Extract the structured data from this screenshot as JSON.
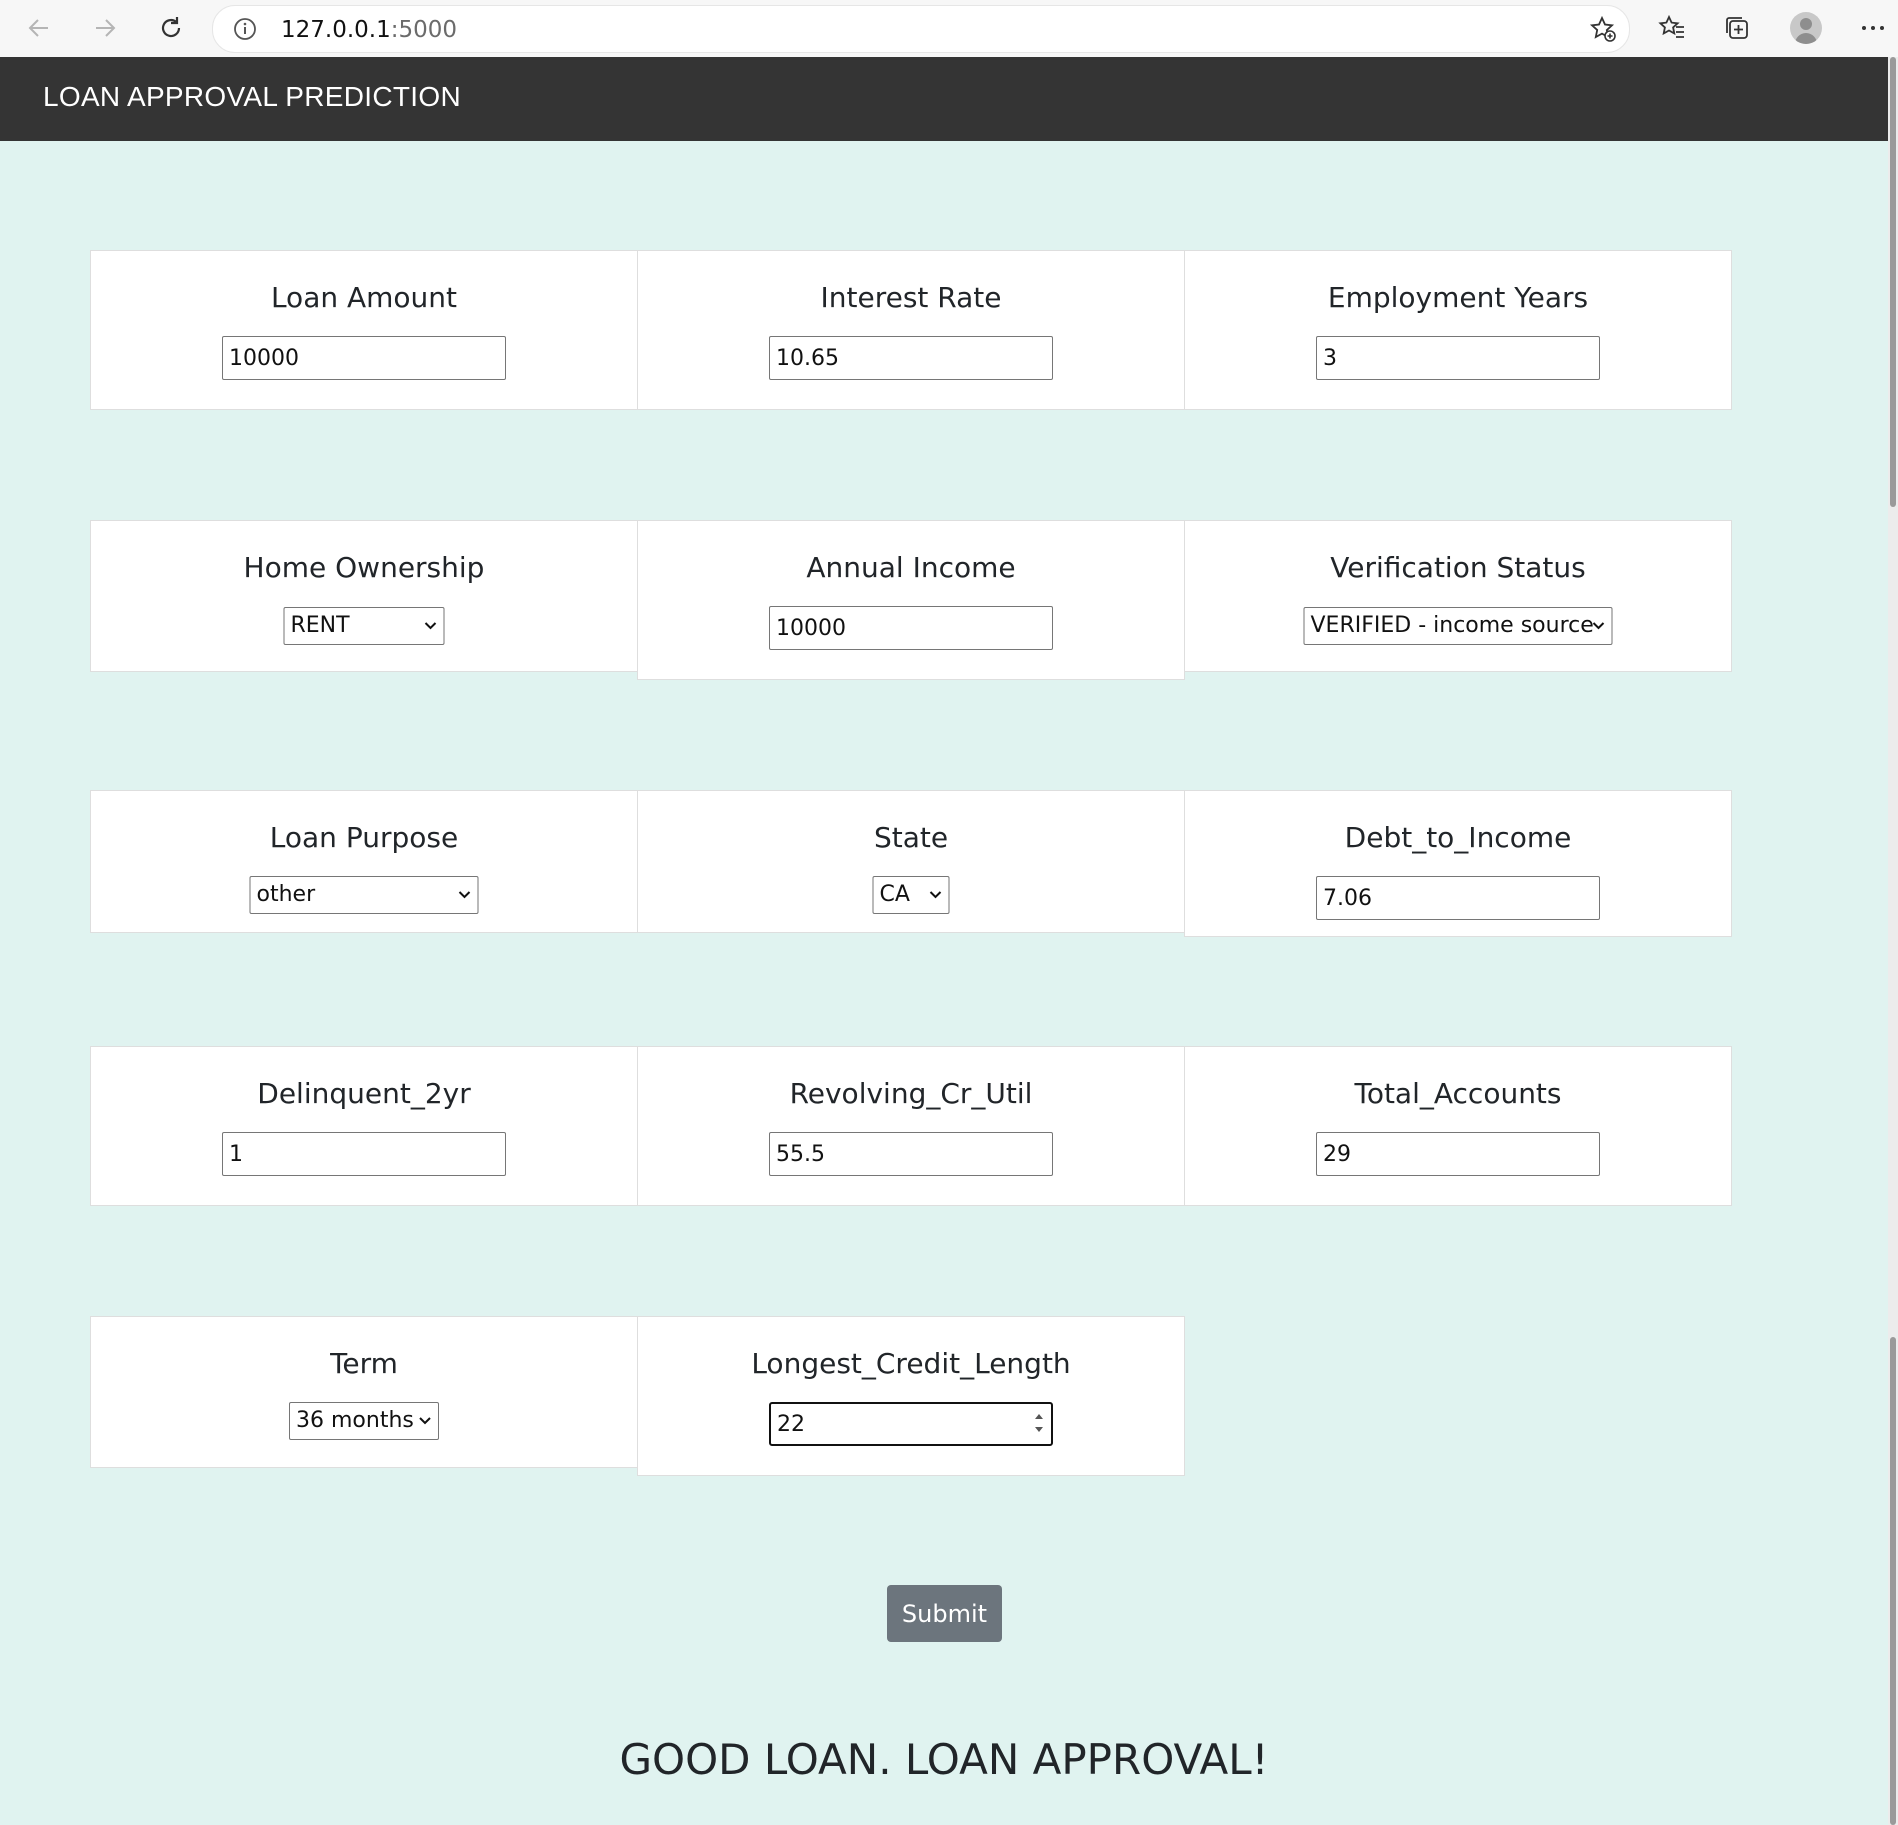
{
  "browser": {
    "url_host": "127.0.0.1",
    "url_port": ":5000"
  },
  "app": {
    "title": "LOAN APPROVAL PREDICTION"
  },
  "form": {
    "loan_amount": {
      "label": "Loan Amount",
      "value": "10000"
    },
    "interest_rate": {
      "label": "Interest Rate",
      "value": "10.65"
    },
    "employment_years": {
      "label": "Employment Years",
      "value": "3"
    },
    "home_ownership": {
      "label": "Home Ownership",
      "selected": "RENT"
    },
    "annual_income": {
      "label": "Annual Income",
      "value": "10000"
    },
    "verification_status": {
      "label": "Verification Status",
      "selected": "VERIFIED - income source"
    },
    "loan_purpose": {
      "label": "Loan Purpose",
      "selected": "other"
    },
    "state": {
      "label": "State",
      "selected": "CA"
    },
    "debt_to_income": {
      "label": "Debt_to_Income",
      "value": "7.06"
    },
    "delinquent_2yr": {
      "label": "Delinquent_2yr",
      "value": "1"
    },
    "revolving_cr_util": {
      "label": "Revolving_Cr_Util",
      "value": "55.5"
    },
    "total_accounts": {
      "label": "Total_Accounts",
      "value": "29"
    },
    "term": {
      "label": "Term",
      "selected": "36 months"
    },
    "longest_credit_length": {
      "label": "Longest_Credit_Length",
      "value": "22"
    },
    "submit_label": "Submit"
  },
  "result": {
    "text": "GOOD LOAN. LOAN APPROVAL!"
  }
}
